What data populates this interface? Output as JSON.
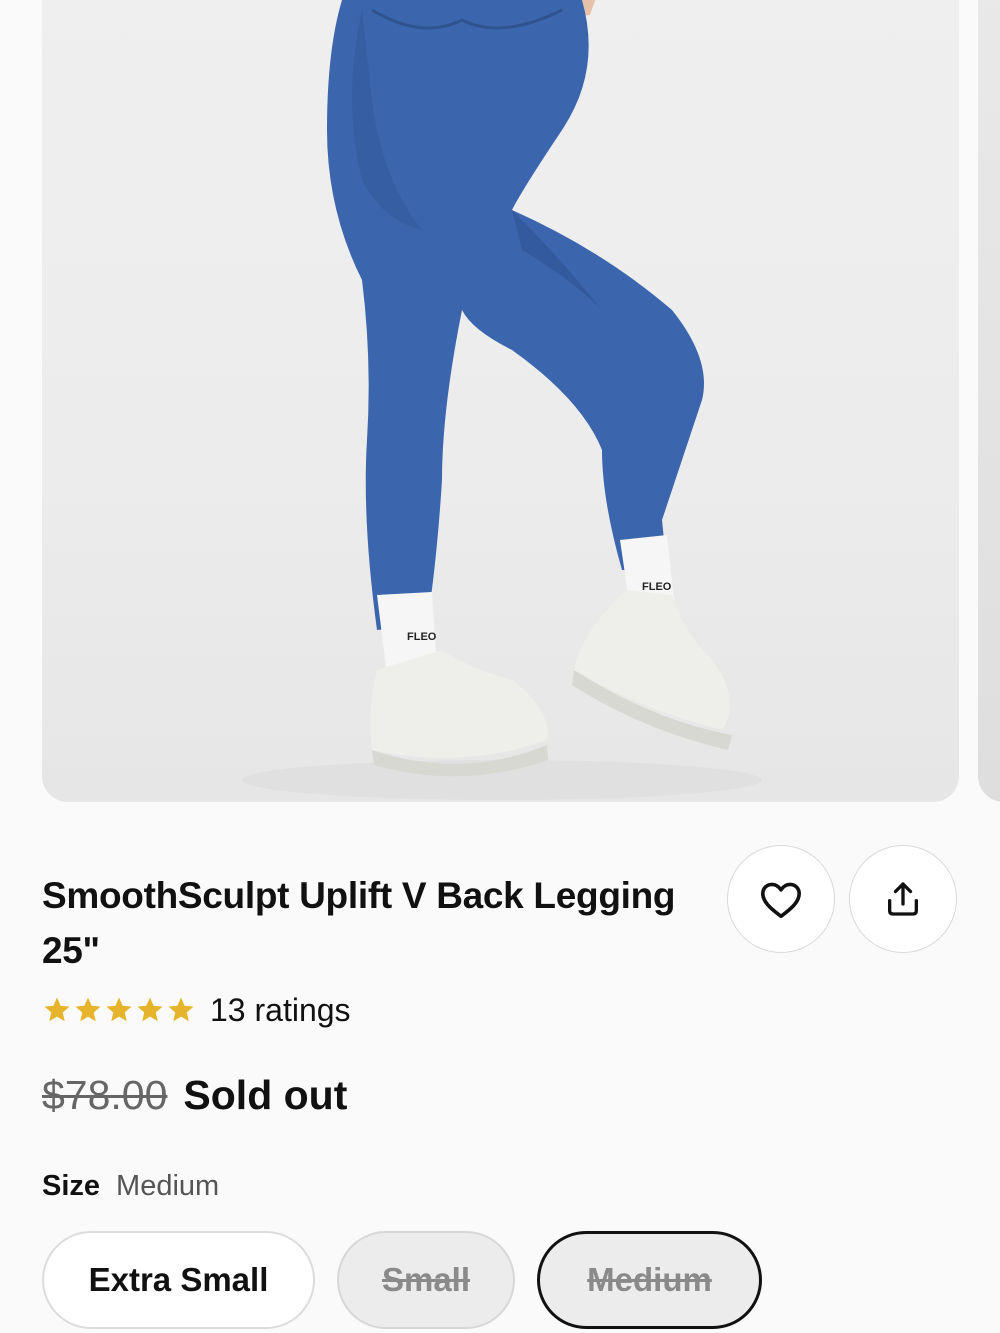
{
  "product": {
    "title": "SmoothSculpt Uplift V Back Legging 25\"",
    "rating_count_text": "13 ratings",
    "stars": 5,
    "original_price": "$78.00",
    "status": "Sold out",
    "sock_logo": "FLEO"
  },
  "size": {
    "label": "Size",
    "selected": "Medium",
    "options": [
      "Extra Small",
      "Small",
      "Medium"
    ]
  },
  "colors": {
    "legging": "#3b66ae",
    "star": "#e6b42a",
    "background": "#fafafa"
  },
  "icons": {
    "favorite": "heart-icon",
    "share": "share-icon"
  }
}
